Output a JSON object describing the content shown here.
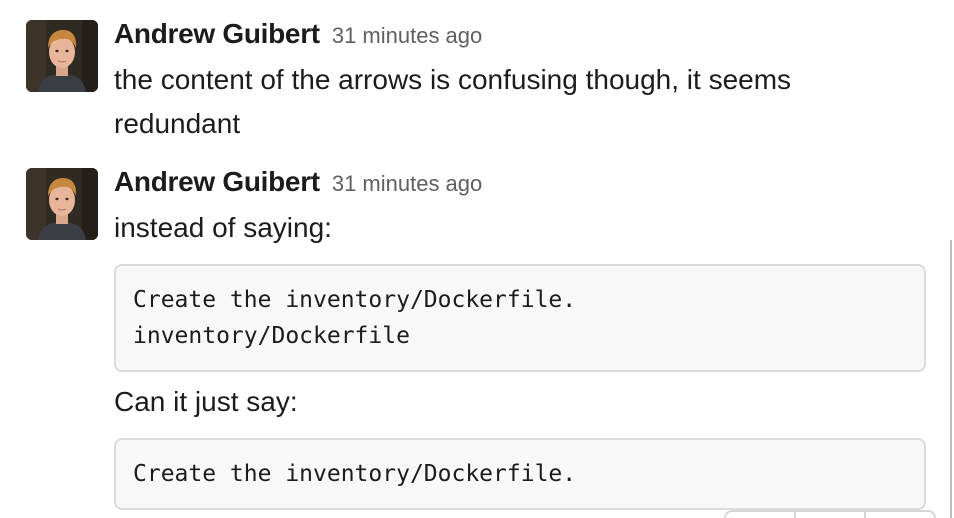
{
  "messages": [
    {
      "author": "Andrew Guibert",
      "timestamp": "31 minutes ago",
      "text_line_1": "the content of the arrows is confusing though, it seems",
      "text_line_2": "redundant"
    },
    {
      "author": "Andrew Guibert",
      "timestamp": "31 minutes ago",
      "text_1": "instead of saying:",
      "code_1_line_1": "Create the inventory/Dockerfile.",
      "code_1_line_2": "inventory/Dockerfile",
      "text_2": "Can it just say:",
      "code_2_line_1": "Create the inventory/Dockerfile."
    }
  ],
  "avatar": {
    "icon": "user-photo-avatar",
    "background": "#2f2a22",
    "skin": "#e8b59a",
    "hair": "#c8873f",
    "shirt": "#3a3d44"
  },
  "message_actions": {
    "icons": [
      "emoji-reaction-icon",
      "reply-thread-icon",
      "more-actions-icon"
    ]
  }
}
